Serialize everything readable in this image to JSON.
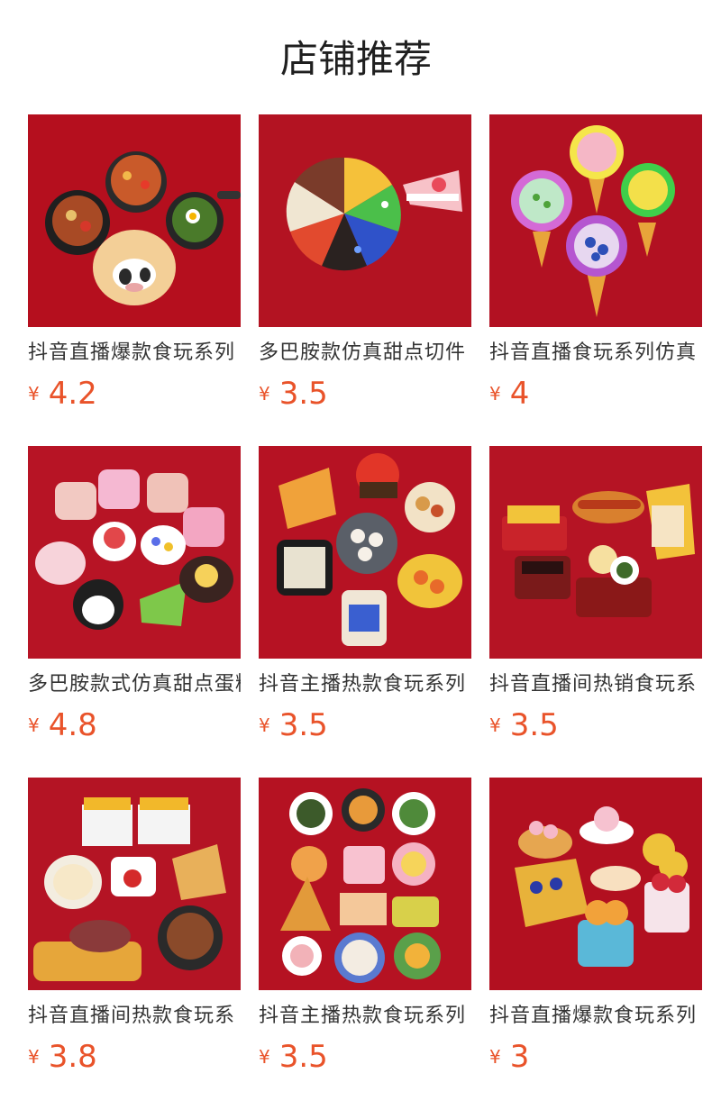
{
  "section": {
    "title": "店铺推荐"
  },
  "currency_symbol": "¥",
  "products": [
    {
      "name": "抖音直播爆款食玩系列",
      "price": "4.2"
    },
    {
      "name": "多巴胺款仿真甜点切件",
      "price": "3.5"
    },
    {
      "name": "抖音直播食玩系列仿真",
      "price": "4"
    },
    {
      "name": "多巴胺款式仿真甜点蛋糕",
      "price": "4.8"
    },
    {
      "name": "抖音主播热款食玩系列",
      "price": "3.5"
    },
    {
      "name": "抖音直播间热销食玩系",
      "price": "3.5"
    },
    {
      "name": "抖音直播间热款食玩系",
      "price": "3.8"
    },
    {
      "name": "抖音主播热款食玩系列",
      "price": "3.5"
    },
    {
      "name": "抖音直播爆款食玩系列",
      "price": "3"
    }
  ],
  "images": [
    {
      "icon": "hotpot-food-magnets-photo",
      "label": ""
    },
    {
      "icon": "cake-slices-photo",
      "label": ""
    },
    {
      "icon": "flower-ice-cream-photo",
      "label": ""
    },
    {
      "icon": "mini-cakes-photo",
      "label": ""
    },
    {
      "icon": "snack-plates-photo",
      "label": ""
    },
    {
      "icon": "fries-hotdog-photo",
      "label": ""
    },
    {
      "icon": "breakfast-snacks-photo",
      "label": "Waffle"
    },
    {
      "icon": "dishes-waffle-photo",
      "label": "Waffle"
    },
    {
      "icon": "desserts-cookie-photo",
      "label": "cookie"
    }
  ],
  "colors": {
    "background": "#ffffff",
    "price": "#e9532a",
    "title": "#1f1f1f",
    "photo_bg": "#b50f1e"
  }
}
